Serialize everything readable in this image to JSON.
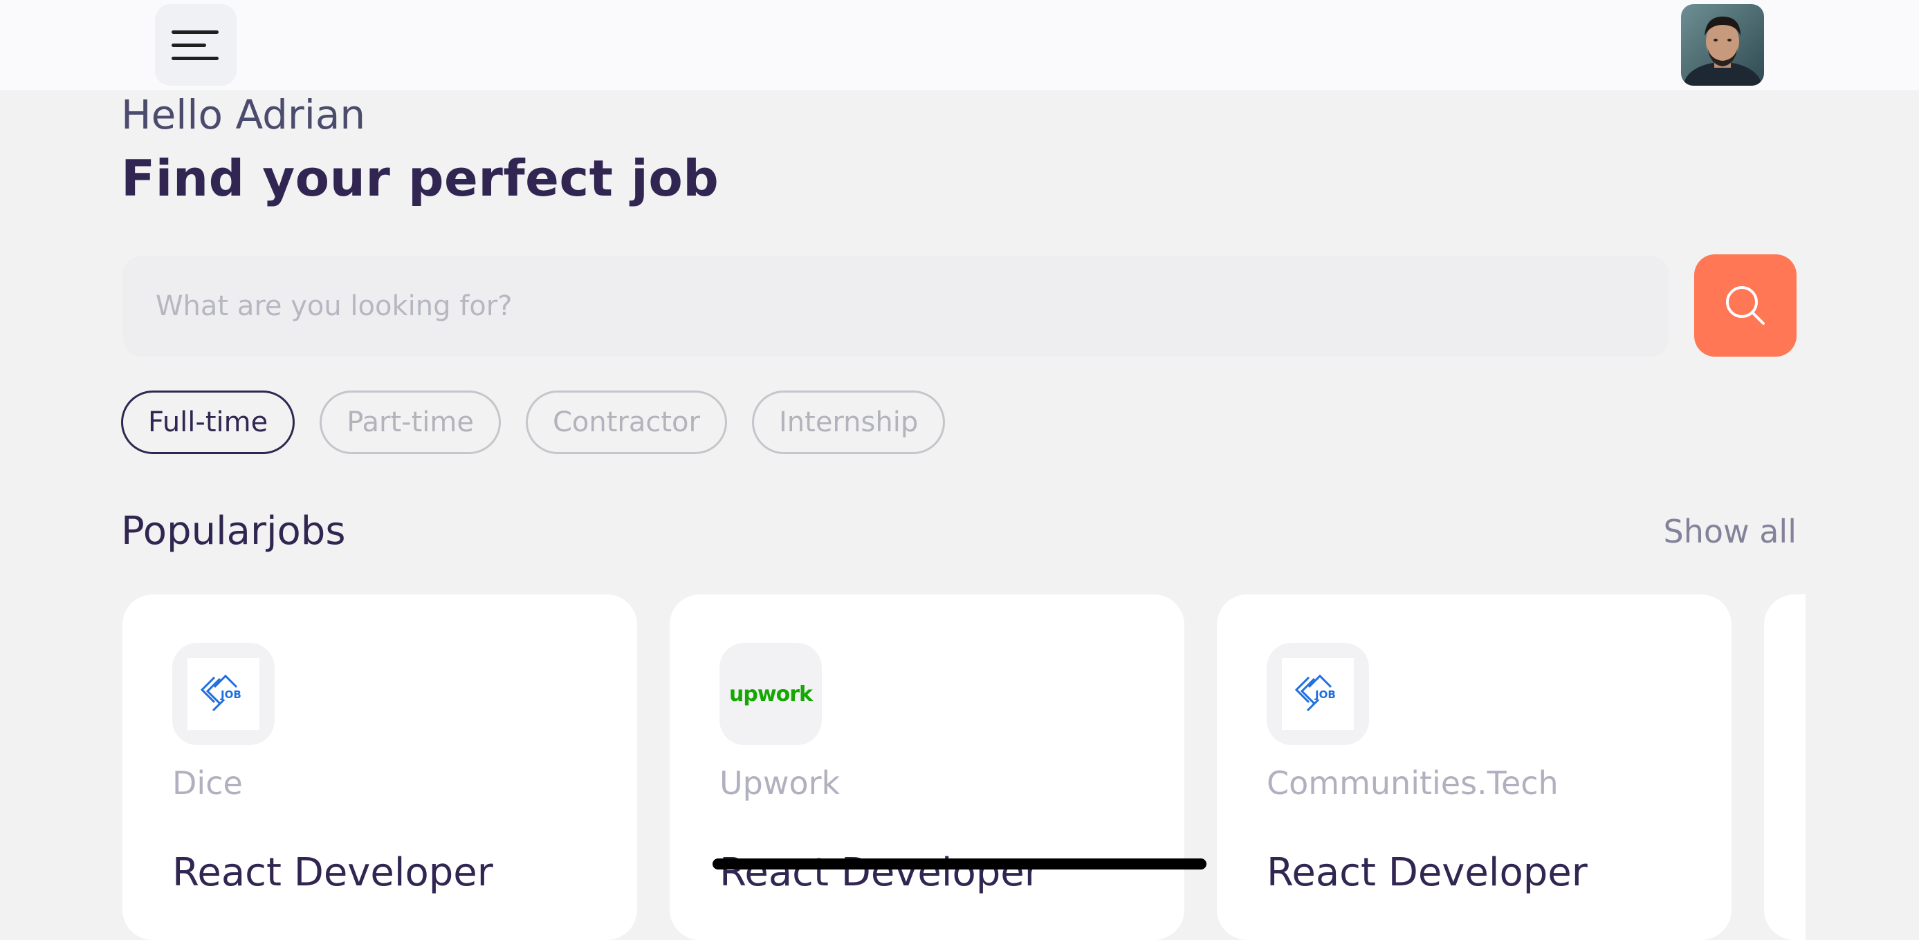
{
  "header": {
    "menu_icon": "hamburger-menu-icon",
    "avatar": "user-avatar"
  },
  "greeting": {
    "hello": "Hello Adrian",
    "headline": "Find your perfect job"
  },
  "search": {
    "placeholder": "What are you looking for?",
    "value": "",
    "button_icon": "search-icon"
  },
  "job_types": [
    {
      "label": "Full-time",
      "active": true
    },
    {
      "label": "Part-time",
      "active": false
    },
    {
      "label": "Contractor",
      "active": false
    },
    {
      "label": "Internship",
      "active": false
    }
  ],
  "popular": {
    "title": "Popularjobs",
    "show_all": "Show all",
    "jobs": [
      {
        "company": "Dice",
        "role": "React Developer",
        "logo": "dice-job-logo",
        "logo_text": "JOB"
      },
      {
        "company": "Upwork",
        "role": "React Developer",
        "logo": "upwork-logo",
        "logo_text": "upwork"
      },
      {
        "company": "Communities.Tech",
        "role": "React Developer",
        "logo": "dice-job-logo",
        "logo_text": "JOB"
      }
    ]
  },
  "colors": {
    "primary": "#312651",
    "accent": "#ff7754",
    "gray": "#83829a",
    "background": "#f2f2f2",
    "upwork_green": "#14a800",
    "job_logo_blue": "#1f6fe0"
  }
}
